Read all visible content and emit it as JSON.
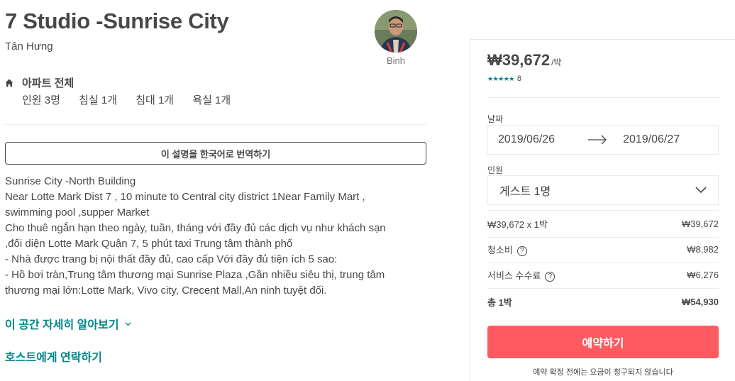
{
  "listing": {
    "title": "7 Studio -Sunrise City",
    "city": "Tân Hưng",
    "host_name": "Binh",
    "type": "아파트 전체",
    "amenities": [
      "인원 3명",
      "침실 1개",
      "침대 1개",
      "욕실 1개"
    ],
    "translate_label": "이 설명을 한국어로 번역하기",
    "description": [
      "Sunrise City -North Building",
      "Near Lotte Mark Dist 7 , 10 minute to Central city district 1Near Family Mart ,",
      "swimming pool ,supper Market",
      "Cho thuê ngắn hạn theo ngày, tuần, tháng với đầy đủ các dịch vụ như khách sạn",
      ",đối diện Lotte Mark Quận 7, 5 phút taxi Trung tâm thành phố",
      "- Nhà được trang bị nội thất đầy đủ, cao cấp Với đầy đủ tiện ích 5 sao:",
      "- Hồ bơi tràn,Trung tâm thương mại Sunrise Plaza ,Gần nhiều siêu thị, trung tâm",
      "thương mại lớn:Lotte Mark, Vivo city, Crecent Mall,An ninh tuyệt đối."
    ],
    "more_link": "이 공간 자세히 알아보기",
    "contact_link": "호스트에게 연락하기"
  },
  "booking": {
    "price": "₩39,672",
    "per_night": "/박",
    "stars": "★★★★★",
    "rating_value": 4.5,
    "review_count": "8",
    "date_label": "날짜",
    "checkin": "2019/06/26",
    "checkout": "2019/06/27",
    "guest_label": "인원",
    "guest_value": "게스트 1명",
    "lines": [
      {
        "label": "₩39,672 x 1박",
        "value": "₩39,672",
        "help": false
      },
      {
        "label": "청소비",
        "value": "₩8,982",
        "help": true
      },
      {
        "label": "서비스 수수료",
        "value": "₩6,276",
        "help": true
      }
    ],
    "total_label": "총 1박",
    "total_value": "₩54,930",
    "book_label": "예약하기",
    "note": "예약 확정 전에는 요금이 청구되지 않습니다",
    "accent": "#ff5a5f",
    "link_color": "#008489"
  }
}
